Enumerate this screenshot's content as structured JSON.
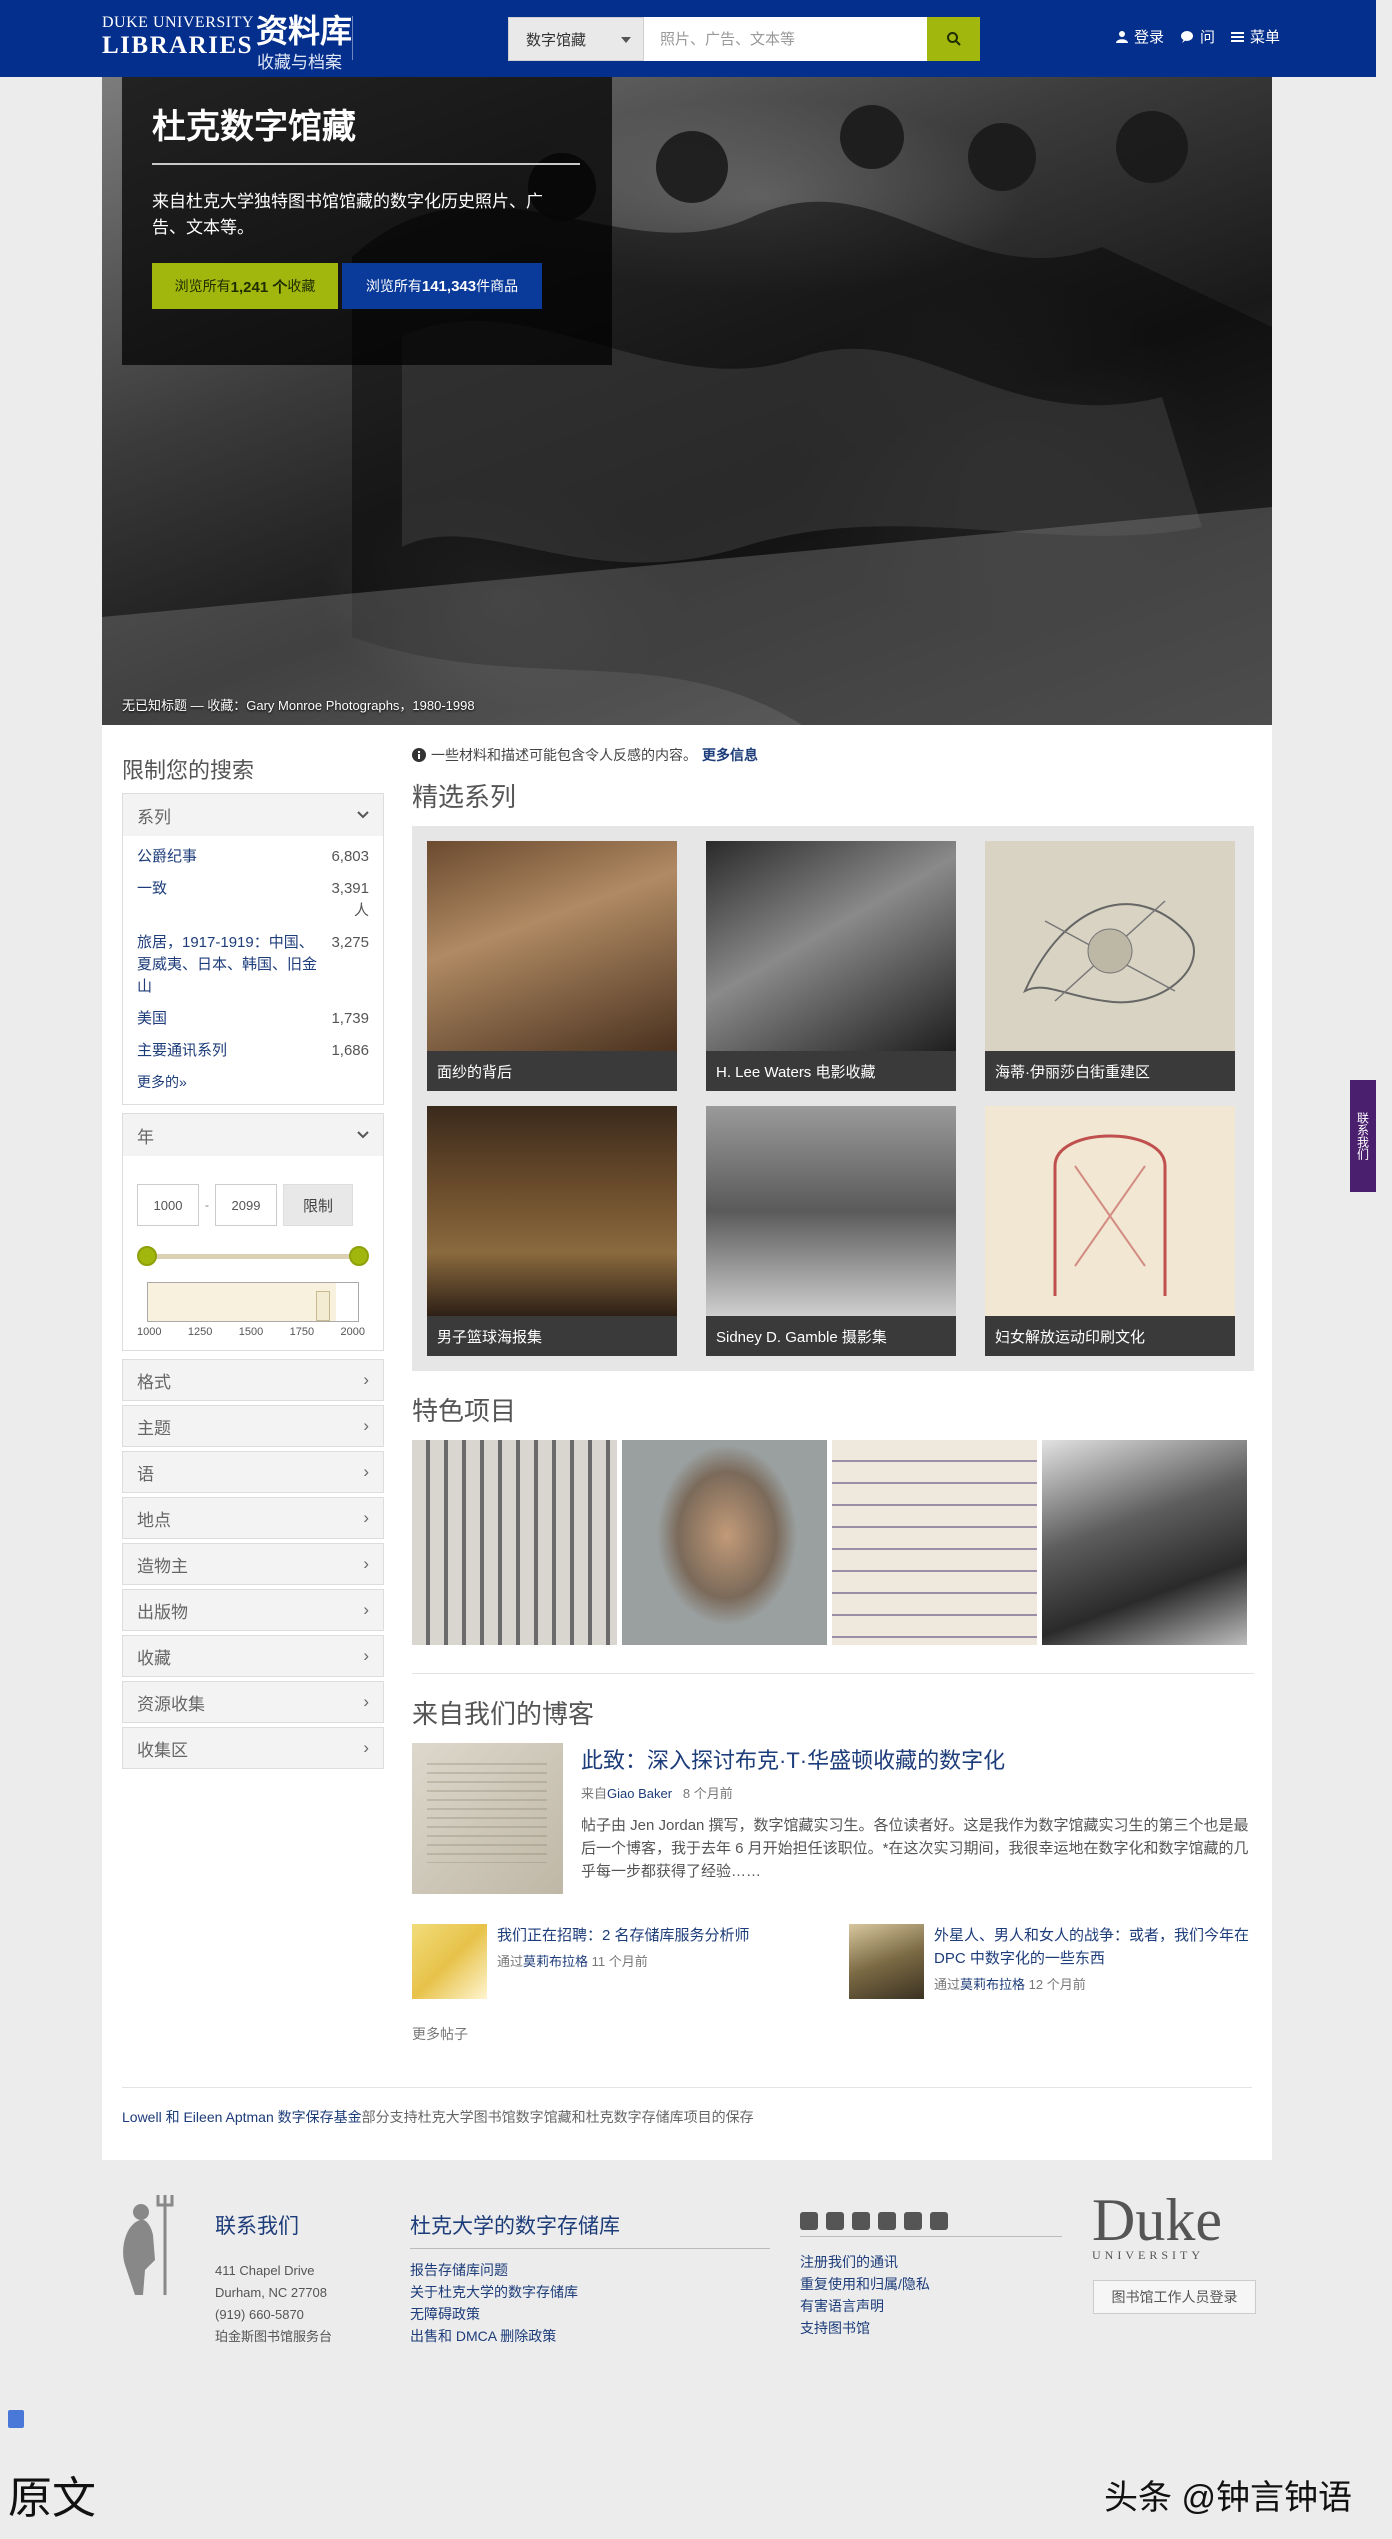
{
  "header": {
    "brand_top": "DUKE UNIVERSITY",
    "brand_bottom": "LIBRARIES",
    "title": "资料库",
    "subtitle": "收藏与档案",
    "search_scope": "数字馆藏",
    "search_placeholder": "照片、广告、文本等",
    "nav": {
      "login": "登录",
      "ask": "问",
      "menu": "菜单"
    }
  },
  "hero": {
    "title": "杜克数字馆藏",
    "description": "来自杜克大学独特图书馆馆藏的数字化历史照片、广告、文本等。",
    "btn_collections_pre": "浏览所有",
    "btn_collections_num": "1,241 个",
    "btn_collections_post": "收藏",
    "btn_items_pre": "浏览所有",
    "btn_items_num": "141,343",
    "btn_items_post": "件商品",
    "caption": "无已知标题 — 收藏：Gary Monroe Photographs，1980-1998"
  },
  "sidebar": {
    "heading": "限制您的搜索",
    "series": {
      "label": "系列",
      "rows": [
        {
          "label": "公爵纪事",
          "count": "6,803"
        },
        {
          "label": "一致",
          "count": "3,391 人"
        },
        {
          "label": "旅居，1917-1919：中国、夏威夷、日本、韩国、旧金山",
          "count": "3,275"
        },
        {
          "label": "美国",
          "count": "1,739"
        },
        {
          "label": "主要通讯系列",
          "count": "1,686"
        }
      ],
      "more": "更多的»"
    },
    "year": {
      "label": "年",
      "from": "1000",
      "to": "2099",
      "dash": "-",
      "button": "限制",
      "ticks": [
        "1000",
        "1250",
        "1500",
        "1750",
        "2000"
      ]
    },
    "facets": [
      "格式",
      "主题",
      "语",
      "地点",
      "造物主",
      "出版物",
      "收藏",
      "资源收集",
      "收集区"
    ]
  },
  "main": {
    "notice": "一些材料和描述可能包含令人反感的内容。",
    "notice_link": "更多信息",
    "featured_title": "精选系列",
    "featured": [
      "面纱的背后",
      "H. Lee Waters 电影收藏",
      "海蒂·伊丽莎白街重建区",
      "男子篮球海报集",
      "Sidney D. Gamble 摄影集",
      "妇女解放运动印刷文化"
    ],
    "items_title": "特色项目",
    "blog_title": "来自我们的博客",
    "blog_main": {
      "title": "此致：深入探讨布克·T·华盛顿收藏的数字化",
      "by": "来自",
      "author": "Giao Baker",
      "time": "8 个月前",
      "excerpt": "帖子由 Jen Jordan 撰写，数字馆藏实习生。各位读者好。这是我作为数字馆藏实习生的第三个也是最后一个博客，我于去年 6 月开始担任该职位。*在这次实习期间，我很幸运地在数字化和数字馆藏的几乎每一步都获得了经验……"
    },
    "blog_minis": [
      {
        "title": "我们正在招聘：2 名存储库服务分析师",
        "by": "通过",
        "author": "莫莉布拉格",
        "time": "11 个月前"
      },
      {
        "title": "外星人、男人和女人的战争：或者，我们今年在 DPC 中数字化的一些东西",
        "by": "通过",
        "author": "莫莉布拉格",
        "time": "12 个月前"
      }
    ],
    "more_posts": "更多帖子",
    "funding_link": "Lowell 和 Eileen Aptman 数字保存基金",
    "funding_rest": "部分支持杜克大学图书馆数字馆藏和杜克数字存储库项目的保存"
  },
  "footer": {
    "contact_title": "联系我们",
    "contact": [
      "411 Chapel Drive",
      "Durham, NC 27708",
      "(919) 660-5870",
      "珀金斯图书馆服务台"
    ],
    "repo_title": "杜克大学的数字存储库",
    "repo_links": [
      "报告存储库问题",
      "关于杜克大学的数字存储库",
      "无障碍政策",
      "出售和 DMCA 删除政策"
    ],
    "other_links": [
      "注册我们的通讯",
      "重复使用和归属/隐私",
      "有害语言声明",
      "支持图书馆"
    ],
    "duke": "Duke",
    "university": "UNIVERSITY",
    "staff_login": "图书馆工作人员登录"
  },
  "feedback_tab": "联系我们",
  "overlay": {
    "left": "原文",
    "right": "头条 @钟言钟语"
  },
  "colors": {
    "header": "#052f8c",
    "accent": "#a1b70d",
    "link": "#1d3c7a"
  }
}
